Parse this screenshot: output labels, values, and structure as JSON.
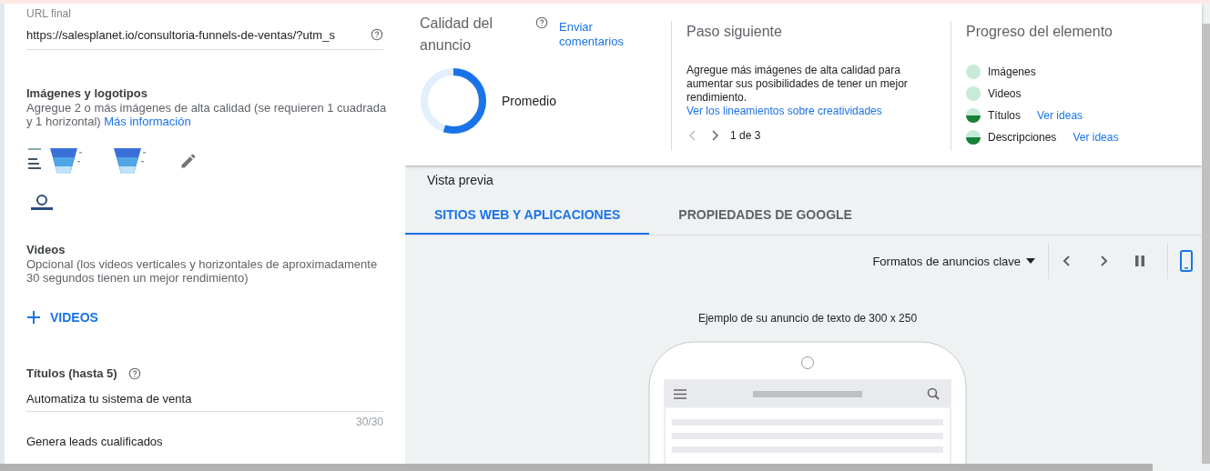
{
  "left_panel": {
    "url_field": {
      "label": "URL final",
      "value": "https://salesplanet.io/consultoria-funnels-de-ventas/?utm_s"
    },
    "images": {
      "heading": "Imágenes y logotipos",
      "description": "Agregue 2 o más imágenes de alta calidad (se requieren 1 cuadrada y 1 horizontal)",
      "link": "Más información"
    },
    "videos": {
      "heading": "Videos",
      "description": "Opcional (los videos verticales y horizontales de aproximadamente 30 segundos tienen un mejor rendimiento)",
      "add_button": "VIDEOS"
    },
    "titles": {
      "heading": "Títulos (hasta 5)",
      "fields": [
        {
          "value": "Automatiza tu sistema de venta",
          "counter": "30/30"
        },
        {
          "value": "Genera leads cualificados"
        }
      ]
    }
  },
  "ad_quality": {
    "title": "Calidad del anuncio",
    "feedback_link": "Enviar comentarios",
    "level": 0.55,
    "rating": "Promedio"
  },
  "next_step": {
    "title": "Paso siguiente",
    "text": "Agregue más imágenes de alta calidad para aumentar sus posibilidades de tener un mejor rendimiento.",
    "link": "Ver los lineamientos sobre creatividades",
    "pager": "1 de 3"
  },
  "element_progress": {
    "title": "Progreso del elemento",
    "items": [
      {
        "label": "Imágenes",
        "kind": "full"
      },
      {
        "label": "Videos",
        "kind": "full"
      },
      {
        "label": "Títulos",
        "kind": "half",
        "link": "Ver ideas"
      },
      {
        "label": "Descripciones",
        "kind": "half",
        "link": "Ver ideas"
      }
    ]
  },
  "preview": {
    "title": "Vista previa",
    "tabs": [
      {
        "label": "SITIOS WEB Y APLICACIONES",
        "selected": true
      },
      {
        "label": "PROPIEDADES DE GOOGLE",
        "selected": false
      }
    ],
    "format_dropdown": "Formatos de anuncios clave",
    "caption": "Ejemplo de su anuncio de texto de 300 x 250"
  }
}
